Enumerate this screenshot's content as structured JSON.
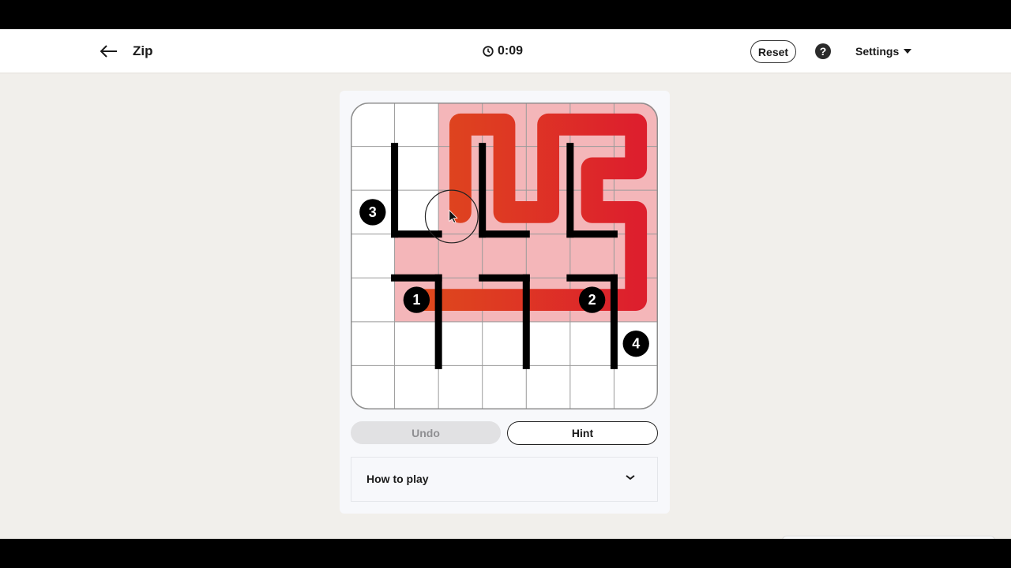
{
  "header": {
    "back_icon": "arrow-left-icon",
    "title": "Zip",
    "timer_icon": "clock-icon",
    "timer": "0:09",
    "reset_label": "Reset",
    "help_icon": "question-circle-icon",
    "help_glyph": "?",
    "settings_label": "Settings",
    "settings_icon": "caret-down-icon"
  },
  "board": {
    "rows": 7,
    "cols": 7,
    "filled_cells": [
      [
        0,
        2
      ],
      [
        0,
        3
      ],
      [
        0,
        4
      ],
      [
        0,
        5
      ],
      [
        0,
        6
      ],
      [
        1,
        2
      ],
      [
        1,
        3
      ],
      [
        1,
        4
      ],
      [
        1,
        5
      ],
      [
        1,
        6
      ],
      [
        2,
        2
      ],
      [
        2,
        3
      ],
      [
        2,
        4
      ],
      [
        2,
        5
      ],
      [
        2,
        6
      ],
      [
        3,
        1
      ],
      [
        3,
        2
      ],
      [
        3,
        3
      ],
      [
        3,
        4
      ],
      [
        3,
        5
      ],
      [
        3,
        6
      ],
      [
        4,
        1
      ],
      [
        4,
        2
      ],
      [
        4,
        3
      ],
      [
        4,
        4
      ],
      [
        4,
        5
      ],
      [
        4,
        6
      ]
    ],
    "path": [
      [
        3,
        4
      ],
      [
        4,
        4
      ],
      [
        4,
        3
      ],
      [
        4,
        2
      ],
      [
        4,
        1
      ],
      [
        4,
        0
      ],
      [
        4,
        5
      ],
      [
        4,
        6
      ],
      [
        4,
        7
      ],
      [
        4,
        8
      ],
      [
        4,
        9
      ],
      [
        5,
        9
      ],
      [
        5,
        10
      ]
    ],
    "path_cells_order": [
      [
        4,
        1
      ],
      [
        4,
        2
      ],
      [
        4,
        3
      ],
      [
        4,
        4
      ],
      [
        4,
        5
      ],
      [
        4,
        6
      ],
      [
        3,
        6
      ],
      [
        2,
        6
      ],
      [
        2,
        5
      ],
      [
        1,
        5
      ],
      [
        1,
        6
      ],
      [
        0,
        6
      ],
      [
        0,
        5
      ],
      [
        0,
        4
      ],
      [
        1,
        4
      ],
      [
        2,
        4
      ],
      [
        2,
        3
      ],
      [
        1,
        3
      ],
      [
        0,
        3
      ],
      [
        0,
        2
      ],
      [
        1,
        2
      ],
      [
        2,
        2
      ]
    ],
    "walls": [
      {
        "from": [
          1,
          1
        ],
        "to": [
          3,
          1
        ]
      },
      {
        "from": [
          3,
          1
        ],
        "to": [
          3,
          2
        ]
      },
      {
        "from": [
          1,
          3
        ],
        "to": [
          3,
          3
        ]
      },
      {
        "from": [
          3,
          3
        ],
        "to": [
          3,
          4
        ]
      },
      {
        "from": [
          1,
          5
        ],
        "to": [
          3,
          5
        ]
      },
      {
        "from": [
          3,
          5
        ],
        "to": [
          3,
          6
        ]
      },
      {
        "from": [
          4,
          1
        ],
        "to": [
          4,
          2
        ]
      },
      {
        "from": [
          4,
          2
        ],
        "to": [
          6,
          2
        ]
      },
      {
        "from": [
          4,
          3
        ],
        "to": [
          4,
          4
        ]
      },
      {
        "from": [
          4,
          4
        ],
        "to": [
          6,
          4
        ]
      },
      {
        "from": [
          4,
          5
        ],
        "to": [
          4,
          6
        ]
      },
      {
        "from": [
          4,
          6
        ],
        "to": [
          6,
          6
        ]
      }
    ],
    "numbers": [
      {
        "value": "1",
        "row": 4,
        "col": 1
      },
      {
        "value": "2",
        "row": 4,
        "col": 5
      },
      {
        "value": "3",
        "row": 2,
        "col": 0
      },
      {
        "value": "4",
        "row": 5,
        "col": 6
      }
    ],
    "cursor": {
      "row": 2,
      "col": 2
    }
  },
  "colors": {
    "path_start": "#de4a1c",
    "path_end": "#dd1f2d",
    "fill": "#f4b6b9",
    "grid": "#9a9a9a",
    "wall": "#000000"
  },
  "controls": {
    "undo_label": "Undo",
    "hint_label": "Hint"
  },
  "how_to_play": {
    "label": "How to play",
    "icon": "chevron-down-icon"
  }
}
